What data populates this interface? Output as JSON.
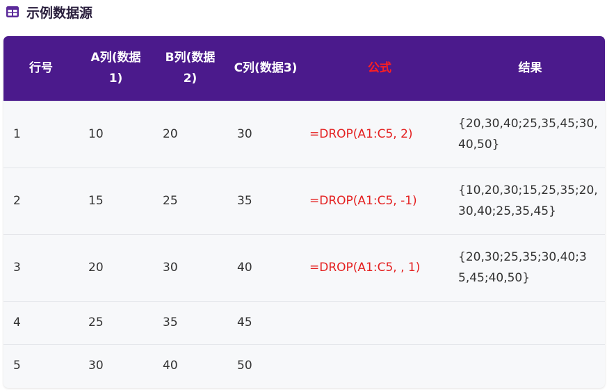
{
  "section": {
    "icon": "table-icon",
    "title": "示例数据源"
  },
  "colors": {
    "header_bg": "#4b1a8c",
    "formula_text": "#e41f1f",
    "formula_header": "#ff1f1f",
    "row_bg": "#f7f8fa"
  },
  "table": {
    "headers": {
      "row": "行号",
      "a": "A列(数据1)",
      "b": "B列(数据2)",
      "c": "C列(数据3)",
      "formula": "公式",
      "result": "结果"
    },
    "rows": [
      {
        "row": "1",
        "a": "10",
        "b": "20",
        "c": "30",
        "formula": "=DROP(A1:C5, 2)",
        "result": "{20,30,40;25,35,45;30,40,50}"
      },
      {
        "row": "2",
        "a": "15",
        "b": "25",
        "c": "35",
        "formula": "=DROP(A1:C5, -1)",
        "result": "{10,20,30;15,25,35;20,30,40;25,35,45}"
      },
      {
        "row": "3",
        "a": "20",
        "b": "30",
        "c": "40",
        "formula": "=DROP(A1:C5, , 1)",
        "result": "{20,30;25,35;30,40;35,45;40,50}"
      },
      {
        "row": "4",
        "a": "25",
        "b": "35",
        "c": "45",
        "formula": "",
        "result": ""
      },
      {
        "row": "5",
        "a": "30",
        "b": "40",
        "c": "50",
        "formula": "",
        "result": ""
      }
    ]
  }
}
